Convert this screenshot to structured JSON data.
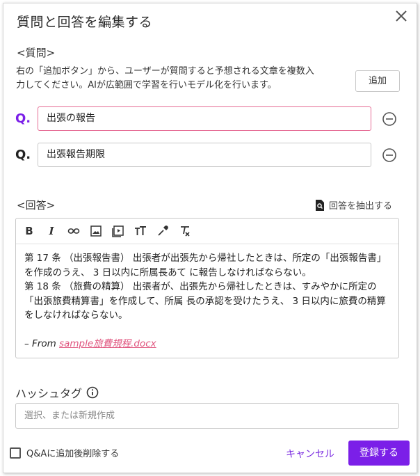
{
  "dialog": {
    "title": "質問と回答を編集する",
    "close_icon": "close-icon"
  },
  "question_section": {
    "label": "<質問>",
    "description_line1": "右の「追加ボタン」から、ユーザーが質問すると予想される文章を複数入",
    "description_line2": "力してください。AIが広範囲で学習を行いモデル化を行います。",
    "add_button": "追加",
    "q_prefix": "Q.",
    "questions": [
      {
        "value": "出張の報告"
      },
      {
        "value": "出張報告期限"
      }
    ]
  },
  "answer_section": {
    "label": "<回答>",
    "extract_label": "回答を抽出する",
    "toolbar": [
      "bold-icon",
      "italic-icon",
      "link-icon",
      "image-icon",
      "video-icon",
      "text-size-icon",
      "color-picker-icon",
      "clear-format-icon"
    ],
    "body": [
      "第 17 条 （出張報告書） 出張者が出張先から帰社したときは、所定の「出張報告書」を作成のうえ、 3 日以内に所属長あて に報告しなければならない。",
      "第 18 条 （旅費の精算） 出張者が、出張先から帰社したときは、すみやかに所定の「出張旅費精算書」を作成して、所属 長の承認を受けたうえ、 3 日以内に旅費の精算をしなければならない。"
    ],
    "source_prefix": "– From ",
    "source_link": "sample旅費規程.docx"
  },
  "hashtag": {
    "label": "ハッシュタグ",
    "placeholder": "選択、または新規作成"
  },
  "footer": {
    "checkbox_label": "Q&Aに追加後削除する",
    "cancel": "キャンセル",
    "register": "登録する"
  },
  "colors": {
    "accent": "#7b1fe8",
    "q_mark": "#7b1fe8",
    "focus_border": "#e56b94",
    "link": "#e0567f"
  }
}
